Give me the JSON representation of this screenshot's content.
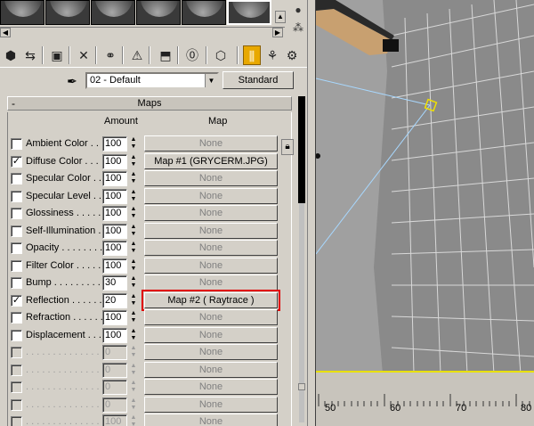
{
  "material": {
    "name": "02 - Default",
    "type_button": "Standard"
  },
  "rollout": {
    "title": "Maps",
    "collapse_symbol": "-",
    "header_amount": "Amount",
    "header_map": "Map"
  },
  "maps": [
    {
      "label": "Ambient Color . . .",
      "checked": false,
      "amount": "100",
      "map": "None",
      "enabled": true
    },
    {
      "label": "Diffuse Color . . .",
      "checked": true,
      "amount": "100",
      "map": "Map #1 (GRYCERM.JPG)",
      "enabled": true
    },
    {
      "label": "Specular Color . .",
      "checked": false,
      "amount": "100",
      "map": "None",
      "enabled": true
    },
    {
      "label": "Specular Level . .",
      "checked": false,
      "amount": "100",
      "map": "None",
      "enabled": true
    },
    {
      "label": "Glossiness . . . . . .",
      "checked": false,
      "amount": "100",
      "map": "None",
      "enabled": true
    },
    {
      "label": "Self-Illumination . .",
      "checked": false,
      "amount": "100",
      "map": "None",
      "enabled": true
    },
    {
      "label": "Opacity . . . . . . . .",
      "checked": false,
      "amount": "100",
      "map": "None",
      "enabled": true
    },
    {
      "label": "Filter Color . . . . .",
      "checked": false,
      "amount": "100",
      "map": "None",
      "enabled": true
    },
    {
      "label": "Bump . . . . . . . . .",
      "checked": false,
      "amount": "30",
      "map": "None",
      "enabled": true
    },
    {
      "label": "Reflection . . . . . .",
      "checked": true,
      "amount": "20",
      "map": "Map #2  ( Raytrace )",
      "enabled": true
    },
    {
      "label": "Refraction . . . . . .",
      "checked": false,
      "amount": "100",
      "map": "None",
      "enabled": true
    },
    {
      "label": "Displacement . . . .",
      "checked": false,
      "amount": "100",
      "map": "None",
      "enabled": true
    },
    {
      "label": ". . . . . . . . . . . . . .",
      "checked": false,
      "amount": "0",
      "map": "None",
      "enabled": false
    },
    {
      "label": ". . . . . . . . . . . . . .",
      "checked": false,
      "amount": "0",
      "map": "None",
      "enabled": false
    },
    {
      "label": ". . . . . . . . . . . . . .",
      "checked": false,
      "amount": "0",
      "map": "None",
      "enabled": false
    },
    {
      "label": ". . . . . . . . . . . . . .",
      "checked": false,
      "amount": "0",
      "map": "None",
      "enabled": false
    },
    {
      "label": ". . . . . . . . . . . . . .",
      "checked": false,
      "amount": "100",
      "map": "None",
      "enabled": false
    }
  ],
  "highlight_map_index": 9,
  "icons": {
    "toolbar": [
      "get-material-icon",
      "put-to-scene-icon",
      "assign-to-selection-icon",
      "reset-map-icon",
      "make-unique-icon",
      "put-to-library-icon",
      "material-effects-channel-icon",
      "show-map-in-viewport-icon",
      "show-end-result-icon",
      "go-to-parent-icon",
      "go-forward-to-sibling-icon"
    ],
    "side": [
      "sample-type-icon",
      "backlight-icon"
    ]
  },
  "timeline": {
    "ticks": [
      "50",
      "60",
      "70",
      "80"
    ]
  },
  "colors": {
    "highlight": "#e00000",
    "active_button": "#e8a800",
    "timeline_border": "#e8e000"
  }
}
